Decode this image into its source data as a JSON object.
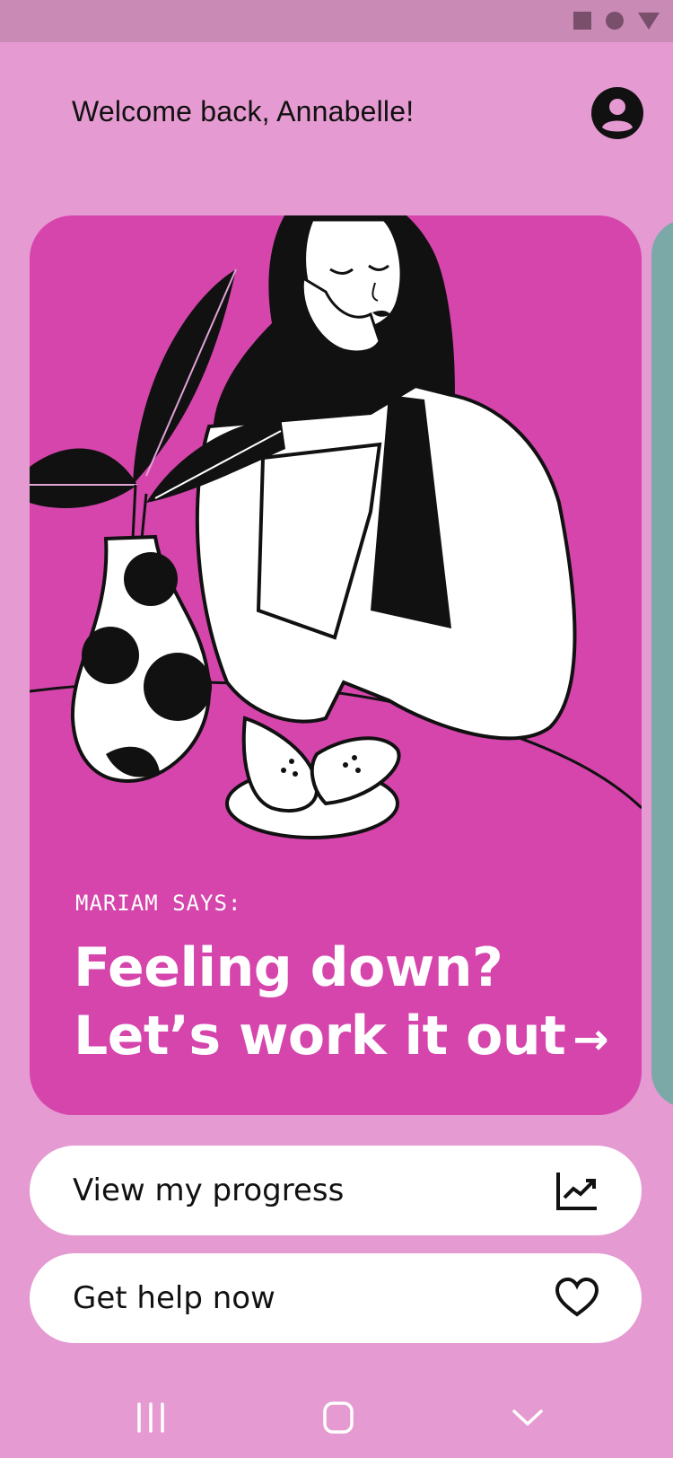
{
  "header": {
    "welcome_text": "Welcome back, Annabelle!",
    "avatar_icon": "user-circle-icon"
  },
  "status_bar": {
    "icons": [
      "square-icon",
      "circle-icon",
      "triangle-down-icon"
    ]
  },
  "feature_card": {
    "eyebrow": "MARIAM SAYS:",
    "title_line1": "Feeling down?",
    "title_line2": "Let’s work it out",
    "arrow": "→",
    "background": "#d545ac",
    "illustration": "woman-resting-head-on-hand-with-plant-vase-and-pears"
  },
  "actions": [
    {
      "label": "View my progress",
      "icon": "trend-chart-icon"
    },
    {
      "label": "Get help now",
      "icon": "heart-icon"
    }
  ],
  "nav": {
    "items": [
      "recent-apps-icon",
      "home-icon",
      "back-chevron-icon"
    ]
  },
  "colors": {
    "page_bg": "#e59ad1",
    "status_bar_bg": "#c98bb6",
    "card_bg": "#d545ac",
    "peek_card_bg": "#7aa9a7",
    "button_bg": "#ffffff"
  }
}
